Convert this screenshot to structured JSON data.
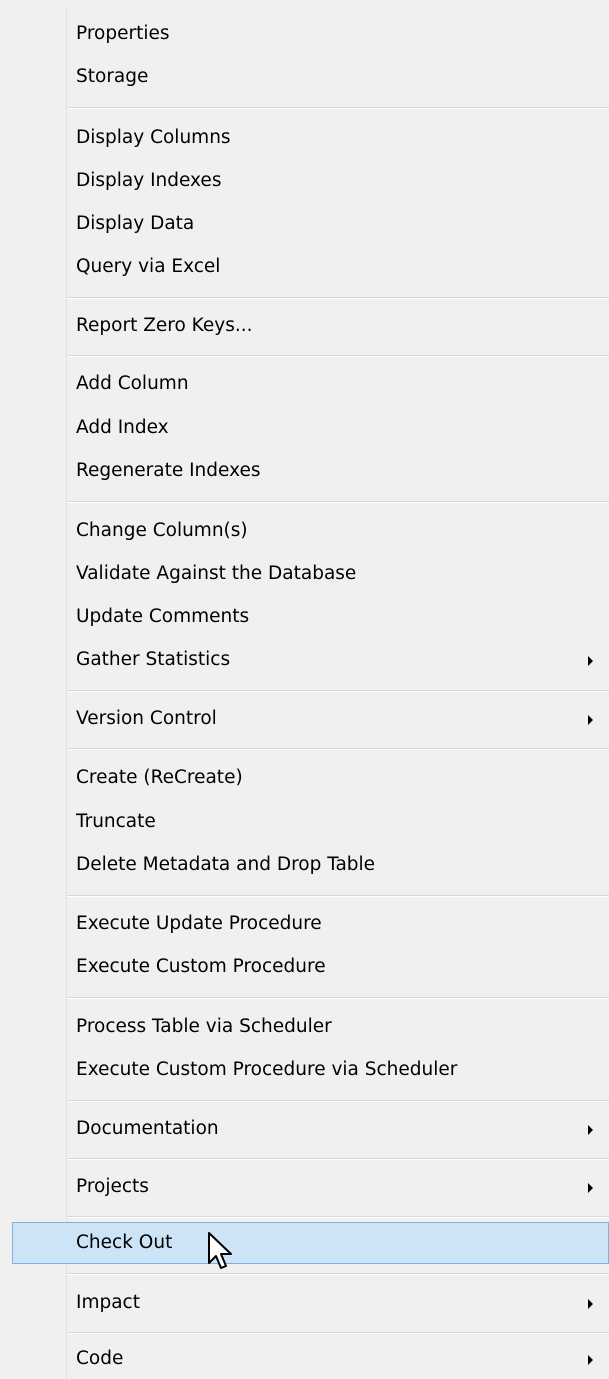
{
  "menu": {
    "items": [
      {
        "label": "Properties",
        "submenu": false
      },
      {
        "label": "Storage",
        "submenu": false
      },
      {
        "label": "Display Columns",
        "submenu": false
      },
      {
        "label": "Display Indexes",
        "submenu": false
      },
      {
        "label": "Display Data",
        "submenu": false
      },
      {
        "label": "Query via Excel",
        "submenu": false
      },
      {
        "label": "Report Zero Keys...",
        "submenu": false
      },
      {
        "label": "Add Column",
        "submenu": false
      },
      {
        "label": "Add Index",
        "submenu": false
      },
      {
        "label": "Regenerate Indexes",
        "submenu": false
      },
      {
        "label": "Change Column(s)",
        "submenu": false
      },
      {
        "label": "Validate Against the Database",
        "submenu": false
      },
      {
        "label": "Update Comments",
        "submenu": false
      },
      {
        "label": "Gather Statistics",
        "submenu": true
      },
      {
        "label": "Version Control",
        "submenu": true
      },
      {
        "label": "Create (ReCreate)",
        "submenu": false
      },
      {
        "label": "Truncate",
        "submenu": false
      },
      {
        "label": "Delete Metadata and Drop Table",
        "submenu": false
      },
      {
        "label": "Execute Update Procedure",
        "submenu": false
      },
      {
        "label": "Execute Custom Procedure",
        "submenu": false
      },
      {
        "label": "Process Table via Scheduler",
        "submenu": false
      },
      {
        "label": "Execute Custom Procedure via Scheduler",
        "submenu": false
      },
      {
        "label": "Documentation",
        "submenu": true
      },
      {
        "label": "Projects",
        "submenu": true
      },
      {
        "label": "Check Out",
        "submenu": false,
        "highlighted": true
      },
      {
        "label": "Impact",
        "submenu": true
      },
      {
        "label": "Code",
        "submenu": true
      }
    ]
  },
  "colors": {
    "background": "#f0f0f0",
    "highlight_fill": "#cde4f7",
    "highlight_border": "#7fb0e0",
    "separator": "#d7d7d7"
  },
  "icons": {
    "submenu_arrow": "chevron-right-icon",
    "cursor": "mouse-pointer-icon"
  }
}
